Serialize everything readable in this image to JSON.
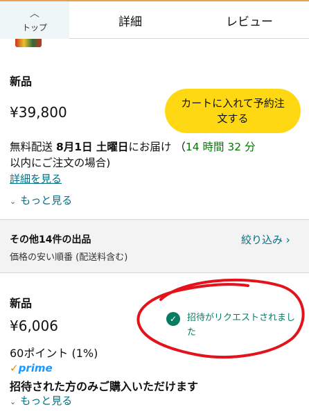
{
  "tabs": {
    "top_label": "トップ",
    "details_label": "詳細",
    "reviews_label": "レビュー"
  },
  "offer_main": {
    "condition": "新品",
    "price": "¥39,800",
    "cart_button": "カートに入れて予約注文する",
    "delivery_prefix": "無料配送 ",
    "delivery_date": "8月1日 土曜日",
    "delivery_mid": "にお届け （",
    "countdown": "14 時間 32 分",
    "delivery_suffix": "以内にご注文の場合)",
    "details_link": "詳細を見る",
    "see_more": "もっと見る"
  },
  "other_sellers": {
    "title": "その他14件の出品",
    "subtitle": "価格の安い順番 (配送料含む)",
    "filter_link": "絞り込み"
  },
  "offer_second": {
    "condition": "新品",
    "price": "¥6,006",
    "points": "60ポイント (1%)",
    "prime": "prime",
    "invite_status": "招待がリクエストされました",
    "invited_only": "招待された方のみご購入いただけます",
    "see_more": "もっと見る"
  },
  "colors": {
    "cart_button": "#ffd814",
    "link": "#007185",
    "countdown": "#007600",
    "invite_green": "#067d62",
    "annotation_red": "#e3121b",
    "prime_blue": "#1a98ff"
  },
  "icons": {
    "tab_top": "chevron-up-icon",
    "see_more": "chevron-down-icon",
    "filter": "chevron-right-icon",
    "invite": "check-circle-icon",
    "prime": "check-icon"
  }
}
